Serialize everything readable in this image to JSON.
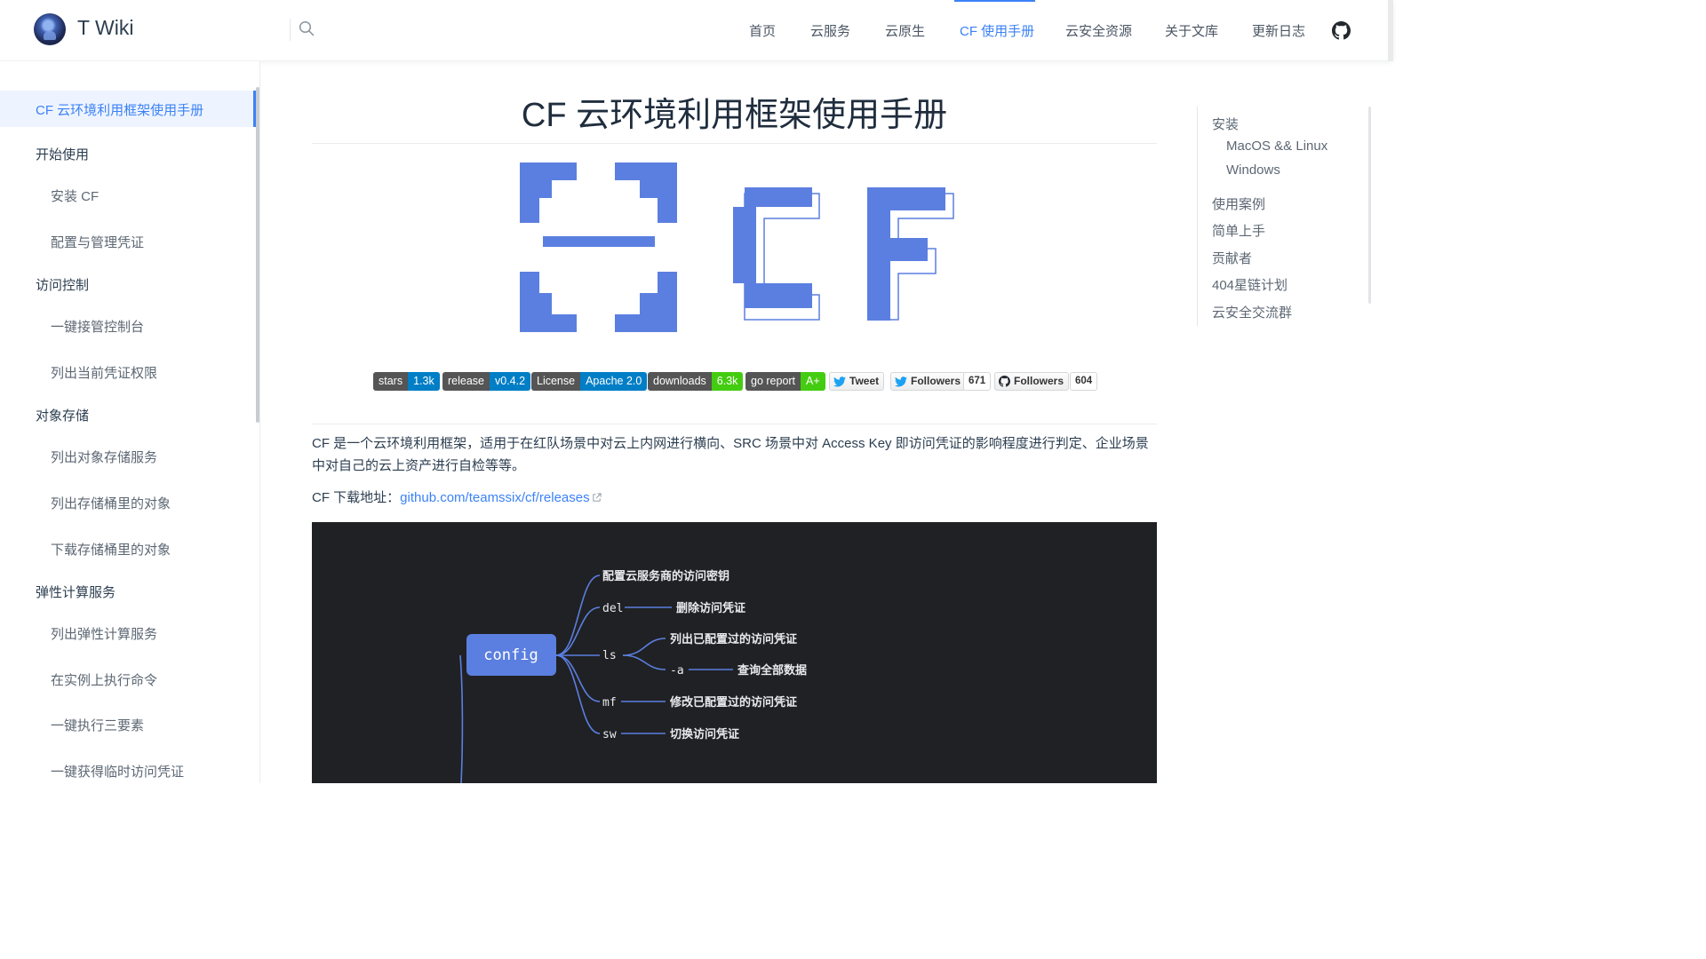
{
  "header": {
    "site_title": "T Wiki",
    "nav": [
      {
        "label": "首页"
      },
      {
        "label": "云服务"
      },
      {
        "label": "云原生"
      },
      {
        "label": "CF 使用手册",
        "active": true
      },
      {
        "label": "云安全资源"
      },
      {
        "label": "关于文库"
      },
      {
        "label": "更新日志"
      }
    ],
    "icons": {
      "search": "search-icon",
      "github": "github-icon"
    },
    "accent_color": "#3b82f6"
  },
  "sidebar": {
    "items": [
      {
        "label": "CF 云环境利用框架使用手册",
        "level": 0,
        "active": true
      },
      {
        "label": "开始使用",
        "level": 0
      },
      {
        "label": "安装 CF",
        "level": 1
      },
      {
        "label": "配置与管理凭证",
        "level": 1
      },
      {
        "label": "访问控制",
        "level": 0
      },
      {
        "label": "一键接管控制台",
        "level": 1
      },
      {
        "label": "列出当前凭证权限",
        "level": 1
      },
      {
        "label": "对象存储",
        "level": 0
      },
      {
        "label": "列出对象存储服务",
        "level": 1
      },
      {
        "label": "列出存储桶里的对象",
        "level": 1
      },
      {
        "label": "下载存储桶里的对象",
        "level": 1
      },
      {
        "label": "弹性计算服务",
        "level": 0
      },
      {
        "label": "列出弹性计算服务",
        "level": 1
      },
      {
        "label": "在实例上执行命令",
        "level": 1
      },
      {
        "label": "一键执行三要素",
        "level": 1
      },
      {
        "label": "一键获得临时访问凭证",
        "level": 1
      }
    ]
  },
  "main": {
    "title": "CF 云环境利用框架使用手册",
    "logo_color": "#5b7fe0",
    "badges": [
      {
        "left": "stars",
        "right": "1.3k",
        "color": "#007ec6"
      },
      {
        "left": "release",
        "right": "v0.4.2",
        "color": "#007ec6"
      },
      {
        "left": "License",
        "right": "Apache 2.0",
        "color": "#007ec6"
      },
      {
        "left": "downloads",
        "right": "6.3k",
        "color": "#4c1"
      },
      {
        "left": "go report",
        "right": "A+",
        "color": "#4c1"
      }
    ],
    "social": {
      "tweet": "Tweet",
      "twitter_followers": "Followers",
      "twitter_count": "671",
      "github_followers": "Followers",
      "github_count": "604"
    },
    "intro": "CF 是一个云环境利用框架，适用于在红队场景中对云上内网进行横向、SRC 场景中对 Access Key 即访问凭证的影响程度进行判定、企业场景中对自己的云上资产进行自检等等。",
    "download_label": "CF 下载地址：",
    "download_link": "github.com/teamssix/cf/releases",
    "mindmap": {
      "root": "config",
      "branches": [
        {
          "cmd": "",
          "desc": "配置云服务商的访问密钥"
        },
        {
          "cmd": "del",
          "desc": "删除访问凭证"
        },
        {
          "cmd": "ls",
          "desc": "列出已配置过的访问凭证"
        },
        {
          "cmd": "-a",
          "desc": "查询全部数据"
        },
        {
          "cmd": "mf",
          "desc": "修改已配置过的访问凭证"
        },
        {
          "cmd": "sw",
          "desc": "切换访问凭证"
        }
      ]
    }
  },
  "toc": {
    "items": [
      {
        "label": "安装",
        "level": 0
      },
      {
        "label": "MacOS && Linux",
        "level": 1
      },
      {
        "label": "Windows",
        "level": 1
      },
      {
        "label": "使用案例",
        "level": 0
      },
      {
        "label": "简单上手",
        "level": 0
      },
      {
        "label": "贡献者",
        "level": 0
      },
      {
        "label": "404星链计划",
        "level": 0
      },
      {
        "label": "云安全交流群",
        "level": 0
      }
    ]
  }
}
